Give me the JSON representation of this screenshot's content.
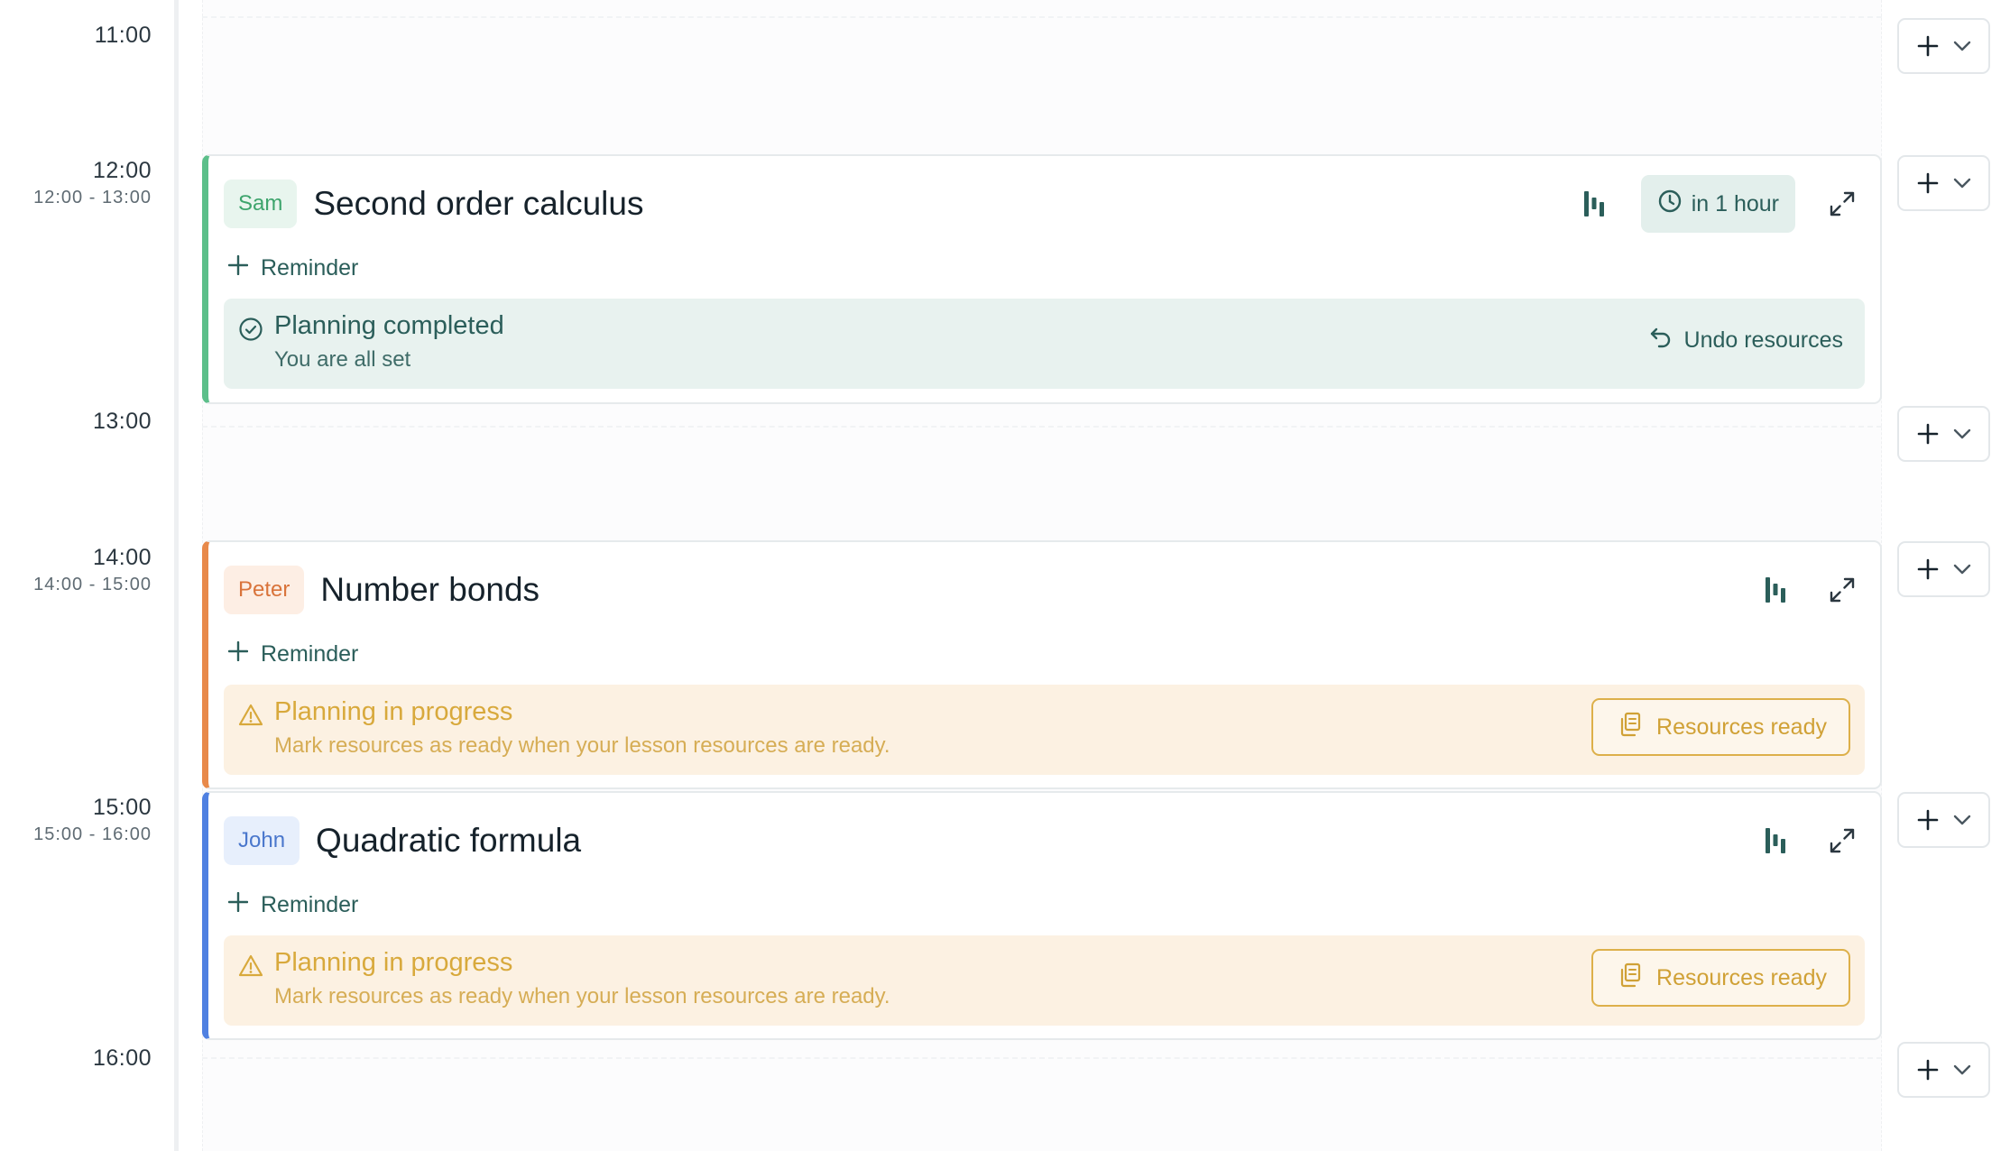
{
  "timeline": {
    "slots": [
      {
        "time": "11:00",
        "range": ""
      },
      {
        "time": "12:00",
        "range": "12:00 - 13:00"
      },
      {
        "time": "13:00",
        "range": ""
      },
      {
        "time": "14:00",
        "range": "14:00 - 15:00"
      },
      {
        "time": "15:00",
        "range": "15:00 - 16:00"
      },
      {
        "time": "16:00",
        "range": ""
      }
    ]
  },
  "lessons": [
    {
      "student": "Sam",
      "title": "Second order calculus",
      "accent": "#5cbf8a",
      "countdown": "in 1 hour",
      "reminder_label": "Reminder",
      "status": {
        "title": "Planning completed",
        "subtitle": "You are all set",
        "action": "Undo resources"
      }
    },
    {
      "student": "Peter",
      "title": "Number bonds",
      "accent": "#e8894a",
      "reminder_label": "Reminder",
      "status": {
        "title": "Planning in progress",
        "subtitle": "Mark resources as ready when your lesson resources are ready.",
        "action": "Resources ready"
      }
    },
    {
      "student": "John",
      "title": "Quadratic formula",
      "accent": "#4f80e1",
      "reminder_label": "Reminder",
      "status": {
        "title": "Planning in progress",
        "subtitle": "Mark resources as ready when your lesson resources are ready.",
        "action": "Resources ready"
      }
    }
  ],
  "icons": {
    "add_slot": "plus-icon",
    "add_menu": "chevron-down-icon",
    "resources": "bars-icon",
    "expand": "expand-icon",
    "clock": "clock-icon",
    "check": "check-circle-icon",
    "warning": "warning-triangle-icon",
    "undo": "undo-arrow-icon",
    "copy": "copy-docs-icon"
  }
}
